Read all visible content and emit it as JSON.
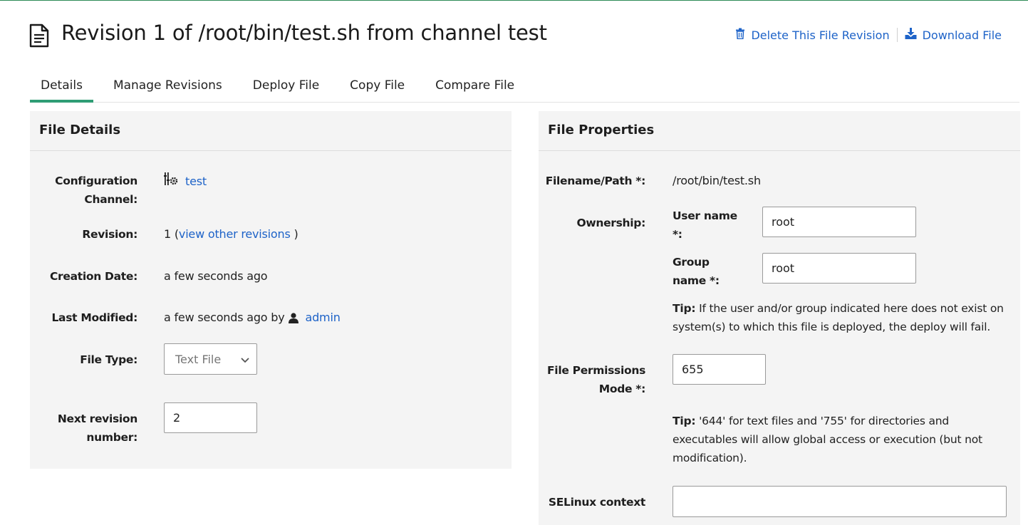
{
  "header": {
    "title": "Revision 1 of /root/bin/test.sh from channel test",
    "delete_label": "Delete This File Revision",
    "download_label": "Download File"
  },
  "tabs": [
    {
      "label": "Details",
      "active": true
    },
    {
      "label": "Manage Revisions",
      "active": false
    },
    {
      "label": "Deploy File",
      "active": false
    },
    {
      "label": "Copy File",
      "active": false
    },
    {
      "label": "Compare File",
      "active": false
    }
  ],
  "file_details": {
    "heading": "File Details",
    "channel_label_1": "Configuration",
    "channel_label_2": "Channel:",
    "channel_value": "test",
    "revision_label": "Revision:",
    "revision_number": "1",
    "revision_open": "(",
    "revision_link": "view other revisions",
    "revision_close": ")",
    "created_label": "Creation Date:",
    "created_value": "a few seconds ago",
    "modified_label": "Last Modified:",
    "modified_value": "a few seconds ago by",
    "modified_user": "admin",
    "type_label": "File Type:",
    "type_value": "Text File",
    "next_rev_label_1": "Next revision",
    "next_rev_label_2": "number:",
    "next_rev_value": "2"
  },
  "file_properties": {
    "heading": "File Properties",
    "path_label": "Filename/Path *:",
    "path_value": "/root/bin/test.sh",
    "ownership_label": "Ownership:",
    "user_label_1": "User name",
    "user_label_2": "*:",
    "user_value": "root",
    "group_label_1": "Group",
    "group_label_2": "name *:",
    "group_value": "root",
    "tip1_bold": "Tip:",
    "tip1_line1": "If the user and/or group indicated here does not exist on",
    "tip1_line2": "system(s) to which this file is deployed, the deploy will fail.",
    "perm_label_1": "File Permissions",
    "perm_label_2": "Mode *:",
    "perm_value": "655",
    "tip2_bold": "Tip:",
    "tip2_line1": "'644' for text files and '755' for directories and",
    "tip2_line2": "executables will allow global access or execution (but not",
    "tip2_line3": "modification).",
    "selinux_label": "SELinux context",
    "selinux_value": ""
  },
  "colors": {
    "link": "#1e63c8",
    "accent": "#2f9d75",
    "panel_bg": "#f4f4f4"
  },
  "icons": [
    "document-icon",
    "trash-icon",
    "download-icon",
    "channel-icon",
    "user-icon",
    "chevron-down-icon"
  ]
}
